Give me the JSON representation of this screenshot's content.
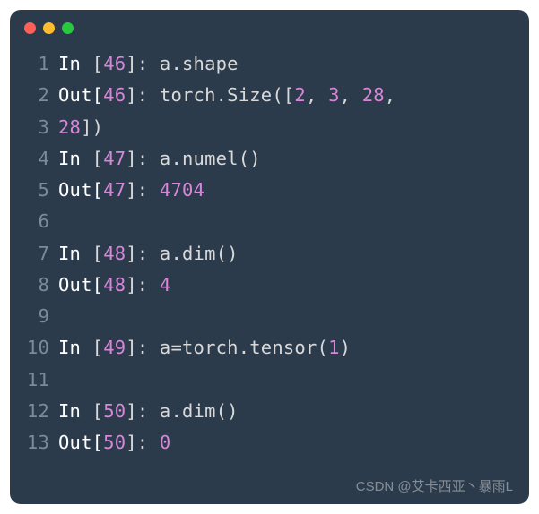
{
  "watermark": "CSDN @艾卡西亚丶暴雨L",
  "lines": [
    {
      "n": "1",
      "segments": [
        {
          "t": "In ",
          "c": "kw-in"
        },
        {
          "t": "[",
          "c": "bracket"
        },
        {
          "t": "46",
          "c": "num"
        },
        {
          "t": "]: ",
          "c": "bracket"
        },
        {
          "t": "a.shape",
          "c": "ident"
        }
      ]
    },
    {
      "n": "2",
      "segments": [
        {
          "t": "Out[",
          "c": "kw-out"
        },
        {
          "t": "46",
          "c": "num"
        },
        {
          "t": "]: ",
          "c": "bracket"
        },
        {
          "t": "torch.Size([",
          "c": "ident"
        },
        {
          "t": "2",
          "c": "int"
        },
        {
          "t": ", ",
          "c": "punct"
        },
        {
          "t": "3",
          "c": "int"
        },
        {
          "t": ", ",
          "c": "punct"
        },
        {
          "t": "28",
          "c": "int"
        },
        {
          "t": ",",
          "c": "punct"
        }
      ]
    },
    {
      "n": "3",
      "segments": [
        {
          "t": "28",
          "c": "int"
        },
        {
          "t": "])",
          "c": "punct"
        }
      ]
    },
    {
      "n": "4",
      "segments": [
        {
          "t": "In ",
          "c": "kw-in"
        },
        {
          "t": "[",
          "c": "bracket"
        },
        {
          "t": "47",
          "c": "num"
        },
        {
          "t": "]: ",
          "c": "bracket"
        },
        {
          "t": "a.numel()",
          "c": "ident"
        }
      ]
    },
    {
      "n": "5",
      "segments": [
        {
          "t": "Out[",
          "c": "kw-out"
        },
        {
          "t": "47",
          "c": "num"
        },
        {
          "t": "]: ",
          "c": "bracket"
        },
        {
          "t": "4704",
          "c": "int"
        }
      ]
    },
    {
      "n": "6",
      "segments": [
        {
          "t": "",
          "c": "ident"
        }
      ]
    },
    {
      "n": "7",
      "segments": [
        {
          "t": "In ",
          "c": "kw-in"
        },
        {
          "t": "[",
          "c": "bracket"
        },
        {
          "t": "48",
          "c": "num"
        },
        {
          "t": "]: ",
          "c": "bracket"
        },
        {
          "t": "a.dim()",
          "c": "ident"
        }
      ]
    },
    {
      "n": "8",
      "segments": [
        {
          "t": "Out[",
          "c": "kw-out"
        },
        {
          "t": "48",
          "c": "num"
        },
        {
          "t": "]: ",
          "c": "bracket"
        },
        {
          "t": "4",
          "c": "int"
        }
      ]
    },
    {
      "n": "9",
      "segments": [
        {
          "t": "",
          "c": "ident"
        }
      ]
    },
    {
      "n": "10",
      "segments": [
        {
          "t": "In ",
          "c": "kw-in"
        },
        {
          "t": "[",
          "c": "bracket"
        },
        {
          "t": "49",
          "c": "num"
        },
        {
          "t": "]: ",
          "c": "bracket"
        },
        {
          "t": "a=torch.tensor(",
          "c": "ident"
        },
        {
          "t": "1",
          "c": "int"
        },
        {
          "t": ")",
          "c": "punct"
        }
      ]
    },
    {
      "n": "11",
      "segments": [
        {
          "t": "",
          "c": "ident"
        }
      ]
    },
    {
      "n": "12",
      "segments": [
        {
          "t": "In ",
          "c": "kw-in"
        },
        {
          "t": "[",
          "c": "bracket"
        },
        {
          "t": "50",
          "c": "num"
        },
        {
          "t": "]: ",
          "c": "bracket"
        },
        {
          "t": "a.dim()",
          "c": "ident"
        }
      ]
    },
    {
      "n": "13",
      "segments": [
        {
          "t": "Out[",
          "c": "kw-out"
        },
        {
          "t": "50",
          "c": "num"
        },
        {
          "t": "]: ",
          "c": "bracket"
        },
        {
          "t": "0",
          "c": "int"
        }
      ]
    }
  ]
}
